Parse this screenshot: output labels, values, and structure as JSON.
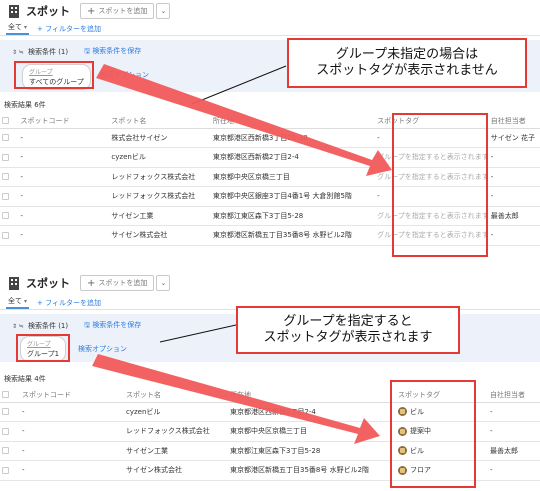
{
  "top": {
    "title": "スポット",
    "add_button": "スポットを追加",
    "all_label": "全て",
    "add_filter": "フィルターを追加",
    "search_cond": "検索条件 (1)",
    "save_cond": "検索条件を保存",
    "group_label": "グループ",
    "group_value": "すべてのグループ",
    "search_option": "検索オプション",
    "result_count": "検索結果 6件",
    "callout_line1": "グループ未指定の場合は",
    "callout_line2": "スポットタグが表示されません",
    "columns": [
      "スポットコード",
      "スポット名",
      "所在地",
      "スポットタグ",
      "自社担当者"
    ],
    "rows": [
      {
        "code": "-",
        "name": "株式会社サイゼン",
        "addr": "東京都港区西新橋3丁目25-30",
        "tag": "-",
        "owner": "サイゼン 花子"
      },
      {
        "code": "-",
        "name": "cyzenビル",
        "addr": "東京都港区西新橋2丁目2-4",
        "tag": "グループを指定すると表示されます",
        "owner": "-"
      },
      {
        "code": "-",
        "name": "レッドフォックス株式会社",
        "addr": "東京都中央区京橋三丁目",
        "tag": "グループを指定すると表示されます",
        "owner": "-"
      },
      {
        "code": "-",
        "name": "レッドフォックス株式会社",
        "addr": "東京都中央区銀座3丁目4番1号 大倉別館5階",
        "tag": "-",
        "owner": "-"
      },
      {
        "code": "-",
        "name": "サイゼン工業",
        "addr": "東京都江東区森下3丁目5-28",
        "tag": "グループを指定すると表示されます",
        "owner": "最善太郎"
      },
      {
        "code": "-",
        "name": "サイゼン株式会社",
        "addr": "東京都港区新橋五丁目35番8号 水野ビル2階",
        "tag": "グループを指定すると表示されます",
        "owner": "-"
      }
    ]
  },
  "bottom": {
    "title": "スポット",
    "add_button": "スポットを追加",
    "all_label": "全て",
    "add_filter": "フィルターを追加",
    "search_cond": "検索条件 (1)",
    "save_cond": "検索条件を保存",
    "group_label": "グループ",
    "group_value": "グループ1",
    "search_option": "検索オプション",
    "result_count": "検索結果 4件",
    "callout_line1": "グループを指定すると",
    "callout_line2": "スポットタグが表示されます",
    "columns": [
      "スポットコード",
      "スポット名",
      "所在地",
      "スポットタグ",
      "自社担当者"
    ],
    "rows": [
      {
        "code": "-",
        "name": "cyzenビル",
        "addr": "東京都港区西新橋2丁目2-4",
        "tag": "ビル",
        "owner": "-"
      },
      {
        "code": "-",
        "name": "レッドフォックス株式会社",
        "addr": "東京都中央区京橋三丁目",
        "tag": "提案中",
        "owner": "-"
      },
      {
        "code": "-",
        "name": "サイゼン工業",
        "addr": "東京都江東区森下3丁目5-28",
        "tag": "ビル",
        "owner": "最善太郎"
      },
      {
        "code": "-",
        "name": "サイゼン株式会社",
        "addr": "東京都港区新橋五丁目35番8号 水野ビル2階",
        "tag": "フロア",
        "owner": "-"
      }
    ]
  },
  "colors": {
    "accent": "#2a7ae2",
    "highlight": "#e53935",
    "cond_bg": "#edf2fa",
    "arrow": "#f25a5a"
  },
  "icons": [
    "building-icon",
    "plus-icon",
    "chevron-down-icon",
    "sort-icon",
    "save-icon",
    "tag-icon"
  ]
}
